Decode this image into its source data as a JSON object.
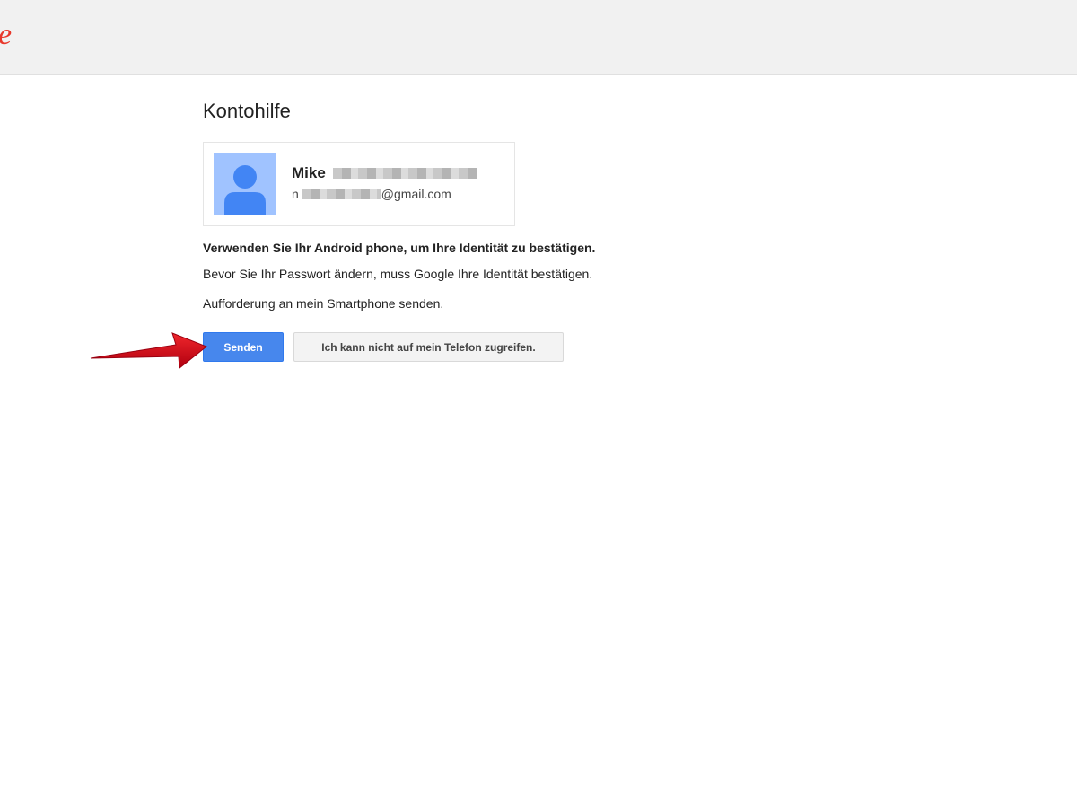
{
  "header": {
    "logo_fragment": "e"
  },
  "main": {
    "title": "Kontohilfe",
    "account": {
      "name": "Mike",
      "email_prefix": "n",
      "email_suffix": "@gmail.com"
    },
    "instruction_heading": "Verwenden Sie Ihr Android phone, um Ihre Identität zu bestätigen.",
    "instruction_text": "Bevor Sie Ihr Passwort ändern, muss Google Ihre Identität bestätigen.",
    "prompt_text": "Aufforderung an mein Smartphone senden.",
    "primary_button": "Senden",
    "secondary_button": "Ich kann nicht auf mein Telefon zugreifen."
  },
  "colors": {
    "header_bg": "#f1f1f1",
    "logo": "#e8382b",
    "primary_button": "#4787ed",
    "avatar_bg": "#a0c3ff",
    "avatar_figure": "#4285f4",
    "annotation_arrow": "#d0021b"
  },
  "icons": {
    "avatar": "default-person-avatar-icon",
    "annotation": "red-arrow-annotation-icon"
  }
}
